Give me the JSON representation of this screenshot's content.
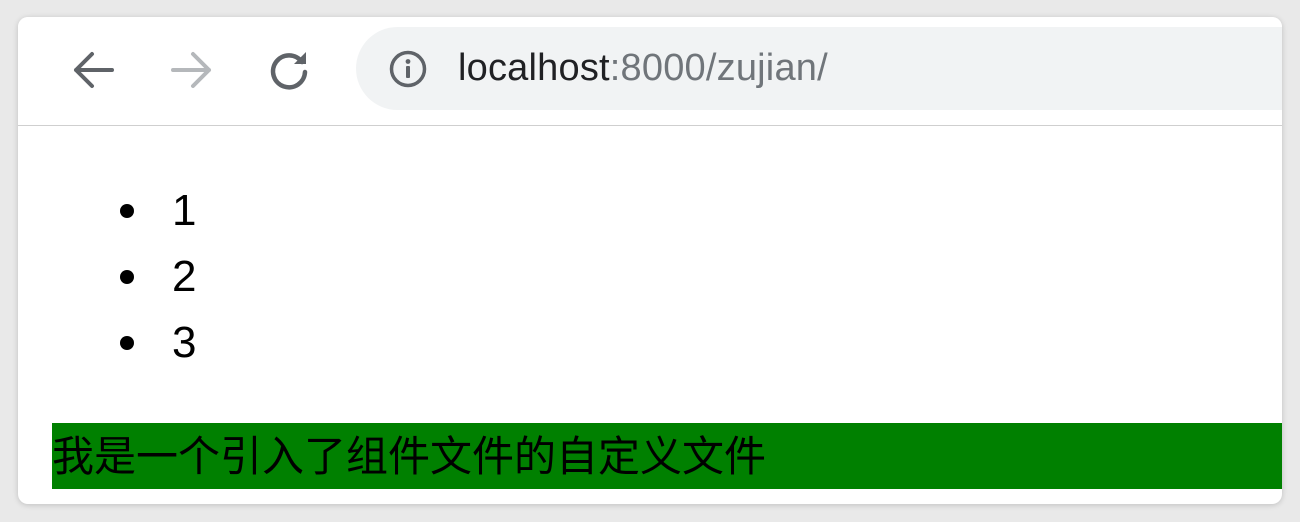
{
  "browser": {
    "url_host": "localhost",
    "url_rest": ":8000/zujian/",
    "icons": {
      "back": "arrow-left-icon",
      "forward": "arrow-right-icon",
      "reload": "reload-icon",
      "info": "info-icon"
    },
    "colors": {
      "toolbar_bg": "#ffffff",
      "omnibox_bg": "#f1f3f4",
      "icon_active": "#5f6368",
      "icon_disabled": "#b5b8bb"
    }
  },
  "page": {
    "list_items": [
      "1",
      "2",
      "3"
    ],
    "banner_text": "我是一个引入了组件文件的自定义文件",
    "banner_color": "#008000"
  }
}
